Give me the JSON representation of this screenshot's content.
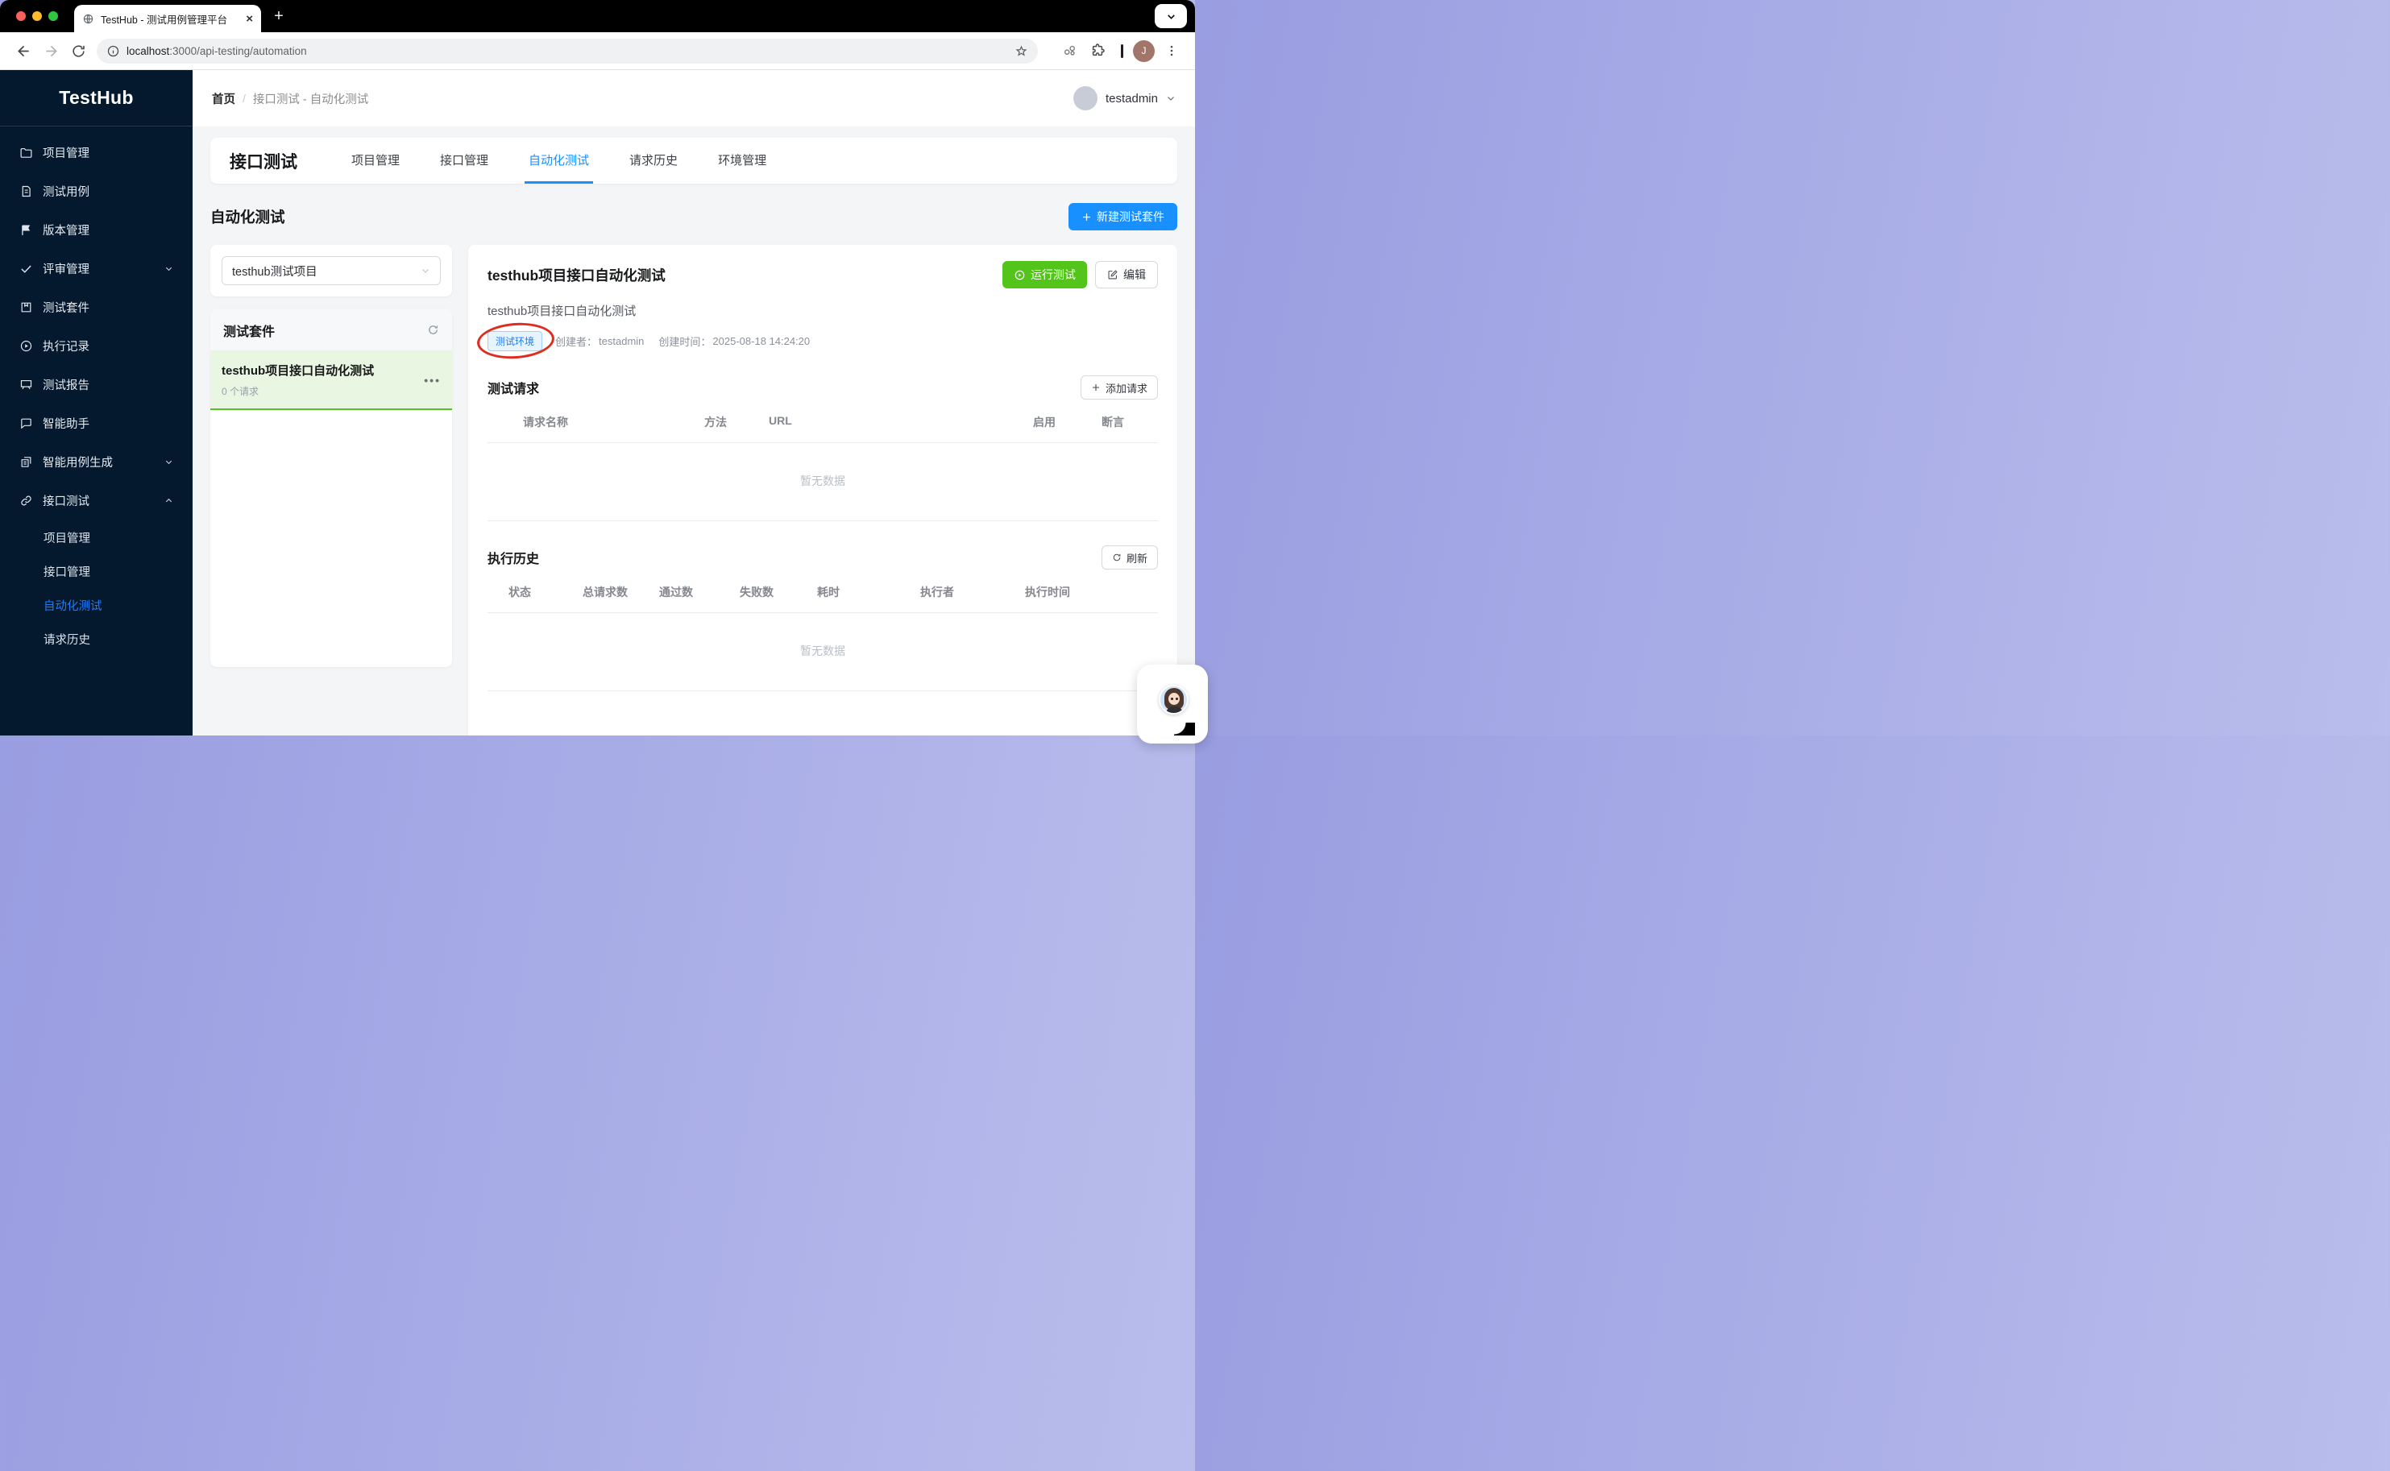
{
  "browser": {
    "tab_title": "TestHub - 测试用例管理平台",
    "url_host": "localhost",
    "url_rest": ":3000/api-testing/automation",
    "profile_initial": "J"
  },
  "sidebar": {
    "logo": "TestHub",
    "items": [
      {
        "label": "项目管理"
      },
      {
        "label": "测试用例"
      },
      {
        "label": "版本管理"
      },
      {
        "label": "评审管理"
      },
      {
        "label": "测试套件"
      },
      {
        "label": "执行记录"
      },
      {
        "label": "测试报告"
      },
      {
        "label": "智能助手"
      },
      {
        "label": "智能用例生成"
      },
      {
        "label": "接口测试"
      }
    ],
    "submenu": [
      {
        "label": "项目管理"
      },
      {
        "label": "接口管理"
      },
      {
        "label": "自动化测试"
      },
      {
        "label": "请求历史"
      }
    ]
  },
  "header": {
    "breadcrumb_home": "首页",
    "breadcrumb_sep": "/",
    "breadcrumb_current": "接口测试 - 自动化测试",
    "username": "testadmin"
  },
  "tabs": {
    "title": "接口测试",
    "items": [
      {
        "label": "项目管理"
      },
      {
        "label": "接口管理"
      },
      {
        "label": "自动化测试"
      },
      {
        "label": "请求历史"
      },
      {
        "label": "环境管理"
      }
    ]
  },
  "page": {
    "section_title": "自动化测试",
    "new_suite_button": "新建测试套件"
  },
  "project_select": {
    "value": "testhub测试项目"
  },
  "suite_panel": {
    "title": "测试套件",
    "suite_name": "testhub项目接口自动化测试",
    "suite_count": "0 个请求"
  },
  "detail": {
    "title": "testhub项目接口自动化测试",
    "run_button": "运行测试",
    "edit_button": "编辑",
    "description": "testhub项目接口自动化测试",
    "env_tag": "测试环境",
    "creator_label": "创建者：",
    "creator": "testadmin",
    "created_label": "创建时间：",
    "created_time": "2025-08-18 14:24:20"
  },
  "requests": {
    "title": "测试请求",
    "add_button": "添加请求",
    "columns": [
      {
        "label": "请求名称"
      },
      {
        "label": "方法"
      },
      {
        "label": "URL"
      },
      {
        "label": "启用"
      },
      {
        "label": "断言"
      }
    ],
    "empty": "暂无数据"
  },
  "history": {
    "title": "执行历史",
    "refresh_button": "刷新",
    "columns": [
      {
        "label": "状态"
      },
      {
        "label": "总请求数"
      },
      {
        "label": "通过数"
      },
      {
        "label": "失败数"
      },
      {
        "label": "耗时"
      },
      {
        "label": "执行者"
      },
      {
        "label": "执行时间"
      }
    ],
    "empty": "暂无数据"
  },
  "colors": {
    "accent_blue": "#1890ff",
    "accent_green": "#52c41a",
    "sidebar_bg": "#04192e",
    "annotation_red": "#df2c20"
  }
}
